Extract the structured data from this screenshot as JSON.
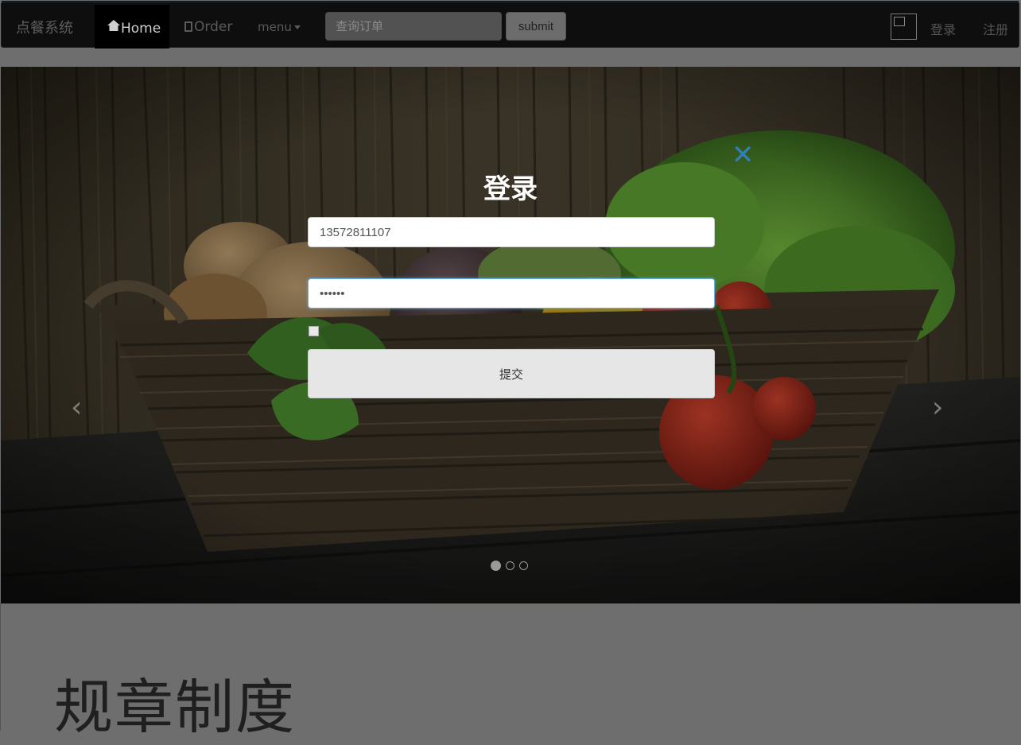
{
  "navbar": {
    "brand": "点餐系统",
    "home_label": "Home",
    "order_label": "Order",
    "menu_label": "menu",
    "search_placeholder": "查询订单",
    "submit_label": "submit",
    "login_label": "登录",
    "register_label": "注册"
  },
  "carousel": {
    "prev_glyph": "‹",
    "next_glyph": "›",
    "indicator_count": 3,
    "active_index": 0
  },
  "login_modal": {
    "close_glyph": "✕",
    "title": "登录",
    "phone_value": "13572811107",
    "password_value": "••••••",
    "submit_label": "提交"
  },
  "page": {
    "section_title": "规章制度"
  },
  "colors": {
    "close_accent": "#2f7fc0",
    "focus_border": "#66afe9"
  }
}
